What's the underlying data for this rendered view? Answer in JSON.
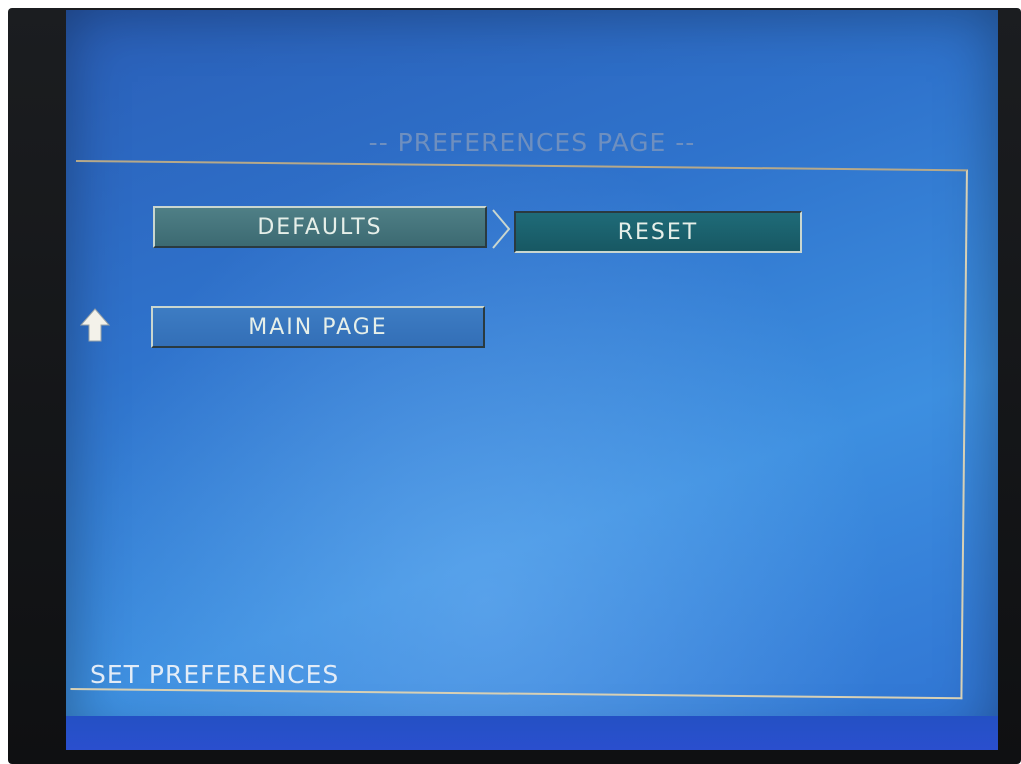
{
  "page": {
    "title": "-- PREFERENCES PAGE --",
    "footer_text": "SET PREFERENCES"
  },
  "buttons": {
    "defaults": "DEFAULTS",
    "reset": "RESET",
    "main_page": "MAIN PAGE"
  },
  "icons": {
    "submenu": "chevron-right-icon",
    "back": "up-arrow-icon"
  },
  "colors": {
    "screen_blue": "#2f73cc",
    "button_teal": "#3c6a72",
    "button_selected": "#175863",
    "button_blue": "#336fb7",
    "text": "#e6efe9"
  }
}
